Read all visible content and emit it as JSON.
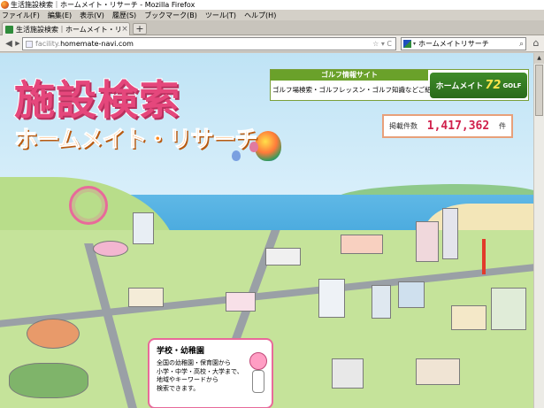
{
  "window": {
    "title": "生活施設検索｜ホームメイト・リサーチ - Mozilla Firefox"
  },
  "menu": [
    "ファイル(F)",
    "編集(E)",
    "表示(V)",
    "履歴(S)",
    "ブックマーク(B)",
    "ツール(T)",
    "ヘルプ(H)"
  ],
  "tab": {
    "label": "生活施設検索｜ホームメイト・リサーチ",
    "close": "×",
    "new_tab": "+"
  },
  "nav": {
    "back": "◀",
    "forward": "▶",
    "url_prefix": "facility.",
    "url_main": "homemate-navi.com",
    "url_controls": "☆ ▾ C",
    "search_text": "ホームメイトリサーチ",
    "search_icon": "⌕",
    "home": "⌂"
  },
  "page": {
    "logo_line1": "施設検索",
    "logo_line2": "ホームメイト・リサーチ",
    "golf": {
      "head": "ゴルフ情報サイト",
      "desc": "ゴルフ場検索・ゴルフレッスン・ゴルフ知識などご紹介",
      "logo_text": "ホームメイト",
      "logo_num": "72",
      "logo_sub": "GOLF"
    },
    "counter": {
      "label": "掲載件数",
      "value": "1,417,362",
      "unit": "件"
    },
    "popup": {
      "title": "学校・幼稚園",
      "lines": [
        "全国の幼稚園・保育園から",
        "小学・中学・高校・大学まで、",
        "地域やキーワードから",
        "検索できます。"
      ]
    }
  },
  "colors": {
    "accent_pink": "#e5477c",
    "accent_orange": "#ff8a1c",
    "golf_green": "#6aa12a",
    "counter_red": "#d0204c"
  }
}
